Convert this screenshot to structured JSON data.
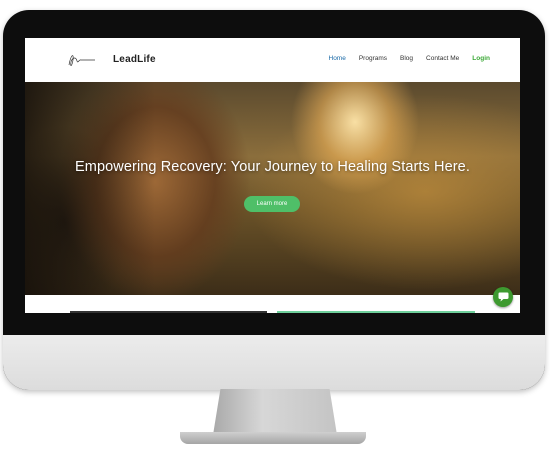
{
  "site": {
    "brand": "LeadLife",
    "nav": [
      "Home",
      "Programs",
      "Blog",
      "Contact Me",
      "Login"
    ]
  },
  "hero": {
    "title": "Empowering Recovery: Your Journey to Healing Starts Here.",
    "button": "Learn more"
  },
  "colors": {
    "accent_green": "#4fbf68",
    "nav_active": "#1a6aa8",
    "login": "#3aa835",
    "chat": "#3e9a30"
  },
  "icons": {
    "logo": "signature-logo-icon",
    "chat": "chat-bubble-icon"
  }
}
